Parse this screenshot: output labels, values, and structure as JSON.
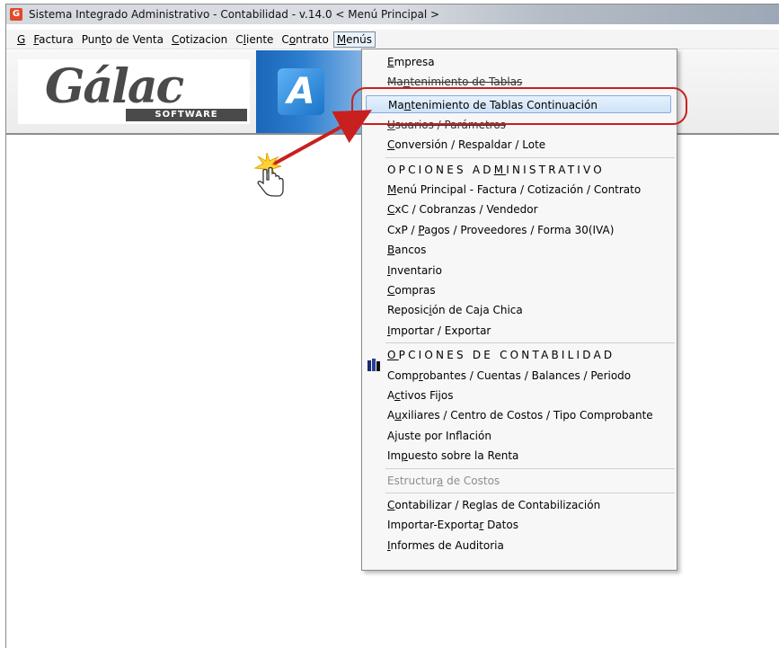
{
  "window": {
    "title": "Sistema Integrado Administrativo - Contabilidad - v.14.0 < Menú Principal >"
  },
  "menubar": {
    "items": [
      {
        "label": "G",
        "mnemonic_index": 0
      },
      {
        "label": "Factura",
        "mnemonic_index": 0
      },
      {
        "label": "Punto de Venta",
        "mnemonic_index": 3
      },
      {
        "label": "Cotizacion",
        "mnemonic_index": 0
      },
      {
        "label": "Cliente",
        "mnemonic_index": 1
      },
      {
        "label": "Contrato",
        "mnemonic_index": 1
      },
      {
        "label": "Menús",
        "mnemonic_index": 0,
        "open": true
      }
    ]
  },
  "logo": {
    "brand": "Gálac",
    "sub": "SOFTWARE",
    "tile": "A"
  },
  "dropdown": {
    "items": [
      {
        "label": "Empresa",
        "ul": 0
      },
      {
        "label": "Mantenimiento de Tablas",
        "ul": 2,
        "strike": true
      },
      {
        "label": "Mantenimiento de Tablas Continuación",
        "ul": 2,
        "highlight": true
      },
      {
        "label": "Usuarios / Parámetros",
        "ul": 0,
        "strike": true
      },
      {
        "label": "Conversión / Respaldar / Lote",
        "ul": 0,
        "sep_after": true
      },
      {
        "label": "OPCIONES ADMINISTRATIVO",
        "ul": 11,
        "section": true
      },
      {
        "label": "Menú Principal - Factura / Cotización / Contrato",
        "ul": 0
      },
      {
        "label": "CxC / Cobranzas / Vendedor",
        "ul": 0
      },
      {
        "label": "CxP / Pagos / Proveedores / Forma 30(IVA)",
        "ul": 6
      },
      {
        "label": "Bancos",
        "ul": 0
      },
      {
        "label": "Inventario",
        "ul": 0
      },
      {
        "label": "Compras",
        "ul": 0
      },
      {
        "label": "Reposición de Caja Chica",
        "ul": 7
      },
      {
        "label": "Importar / Exportar",
        "ul": 0,
        "sep_after": true
      },
      {
        "label": "OPCIONES DE CONTABILIDAD",
        "ul": 0,
        "section": true,
        "icon": "books-icon"
      },
      {
        "label": "Comprobantes / Cuentas / Balances / Periodo",
        "ul": 4
      },
      {
        "label": "Activos Fijos",
        "ul": 1
      },
      {
        "label": "Auxiliares / Centro de Costos / Tipo Comprobante",
        "ul": 1
      },
      {
        "label": "Ajuste por Inflación",
        "ul": 1
      },
      {
        "label": "Impuesto sobre la Renta",
        "ul": 2,
        "sep_after": true
      },
      {
        "label": "Estructura de Costos",
        "ul": 9,
        "disabled": true,
        "sep_after": true
      },
      {
        "label": "Contabilizar / Reglas de Contabilización",
        "ul": 0
      },
      {
        "label": "Importar-Exportar Datos",
        "ul": 16
      },
      {
        "label": "Informes de Auditoria",
        "ul": 0
      }
    ]
  },
  "colors": {
    "accent_red": "#c8201f",
    "highlight_blue": "#cde3f8",
    "app_icon": "#e04a2a"
  }
}
